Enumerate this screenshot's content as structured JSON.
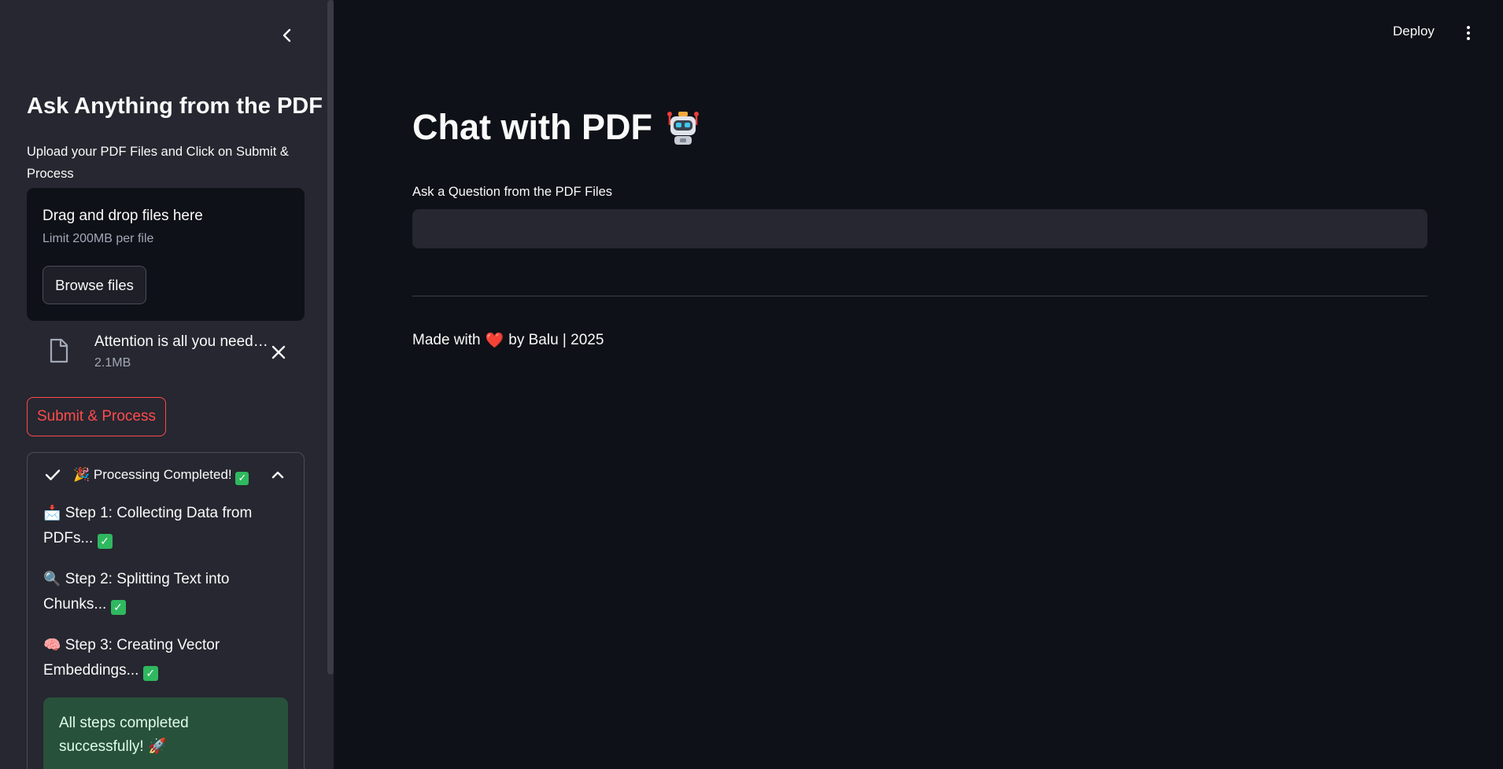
{
  "sidebar": {
    "title": "Ask Anything from the PDF",
    "description": "Upload your PDF Files and Click on Submit & Process",
    "uploader": {
      "dropzone_title": "Drag and drop files here",
      "limit_text": "Limit 200MB per file",
      "browse_label": "Browse files"
    },
    "file": {
      "name": "Attention is all you need…",
      "size": "2.1MB"
    },
    "submit_label": "Submit & Process",
    "status": {
      "label": "🎉 Processing Completed!",
      "steps": [
        {
          "icon": "📩",
          "text": "Step 1: Collecting Data from PDFs..."
        },
        {
          "icon": "🔍",
          "text": "Step 2: Splitting Text into Chunks..."
        },
        {
          "icon": "🧠",
          "text": "Step 3: Creating Vector Embeddings..."
        }
      ],
      "success_text": "All steps completed successfully! 🚀"
    }
  },
  "header": {
    "deploy_label": "Deploy"
  },
  "main": {
    "title": "Chat with PDF",
    "question_label": "Ask a Question from the PDF Files",
    "question_value": "",
    "footer": {
      "made_with": "Made with",
      "heart": "❤️",
      "by": "by Balu | 2025"
    }
  },
  "colors": {
    "background": "#0e1117",
    "sidebar": "#262730",
    "accent": "#ff4b4b",
    "success_bg": "#28513b",
    "checkmark": "#2fb85f"
  }
}
